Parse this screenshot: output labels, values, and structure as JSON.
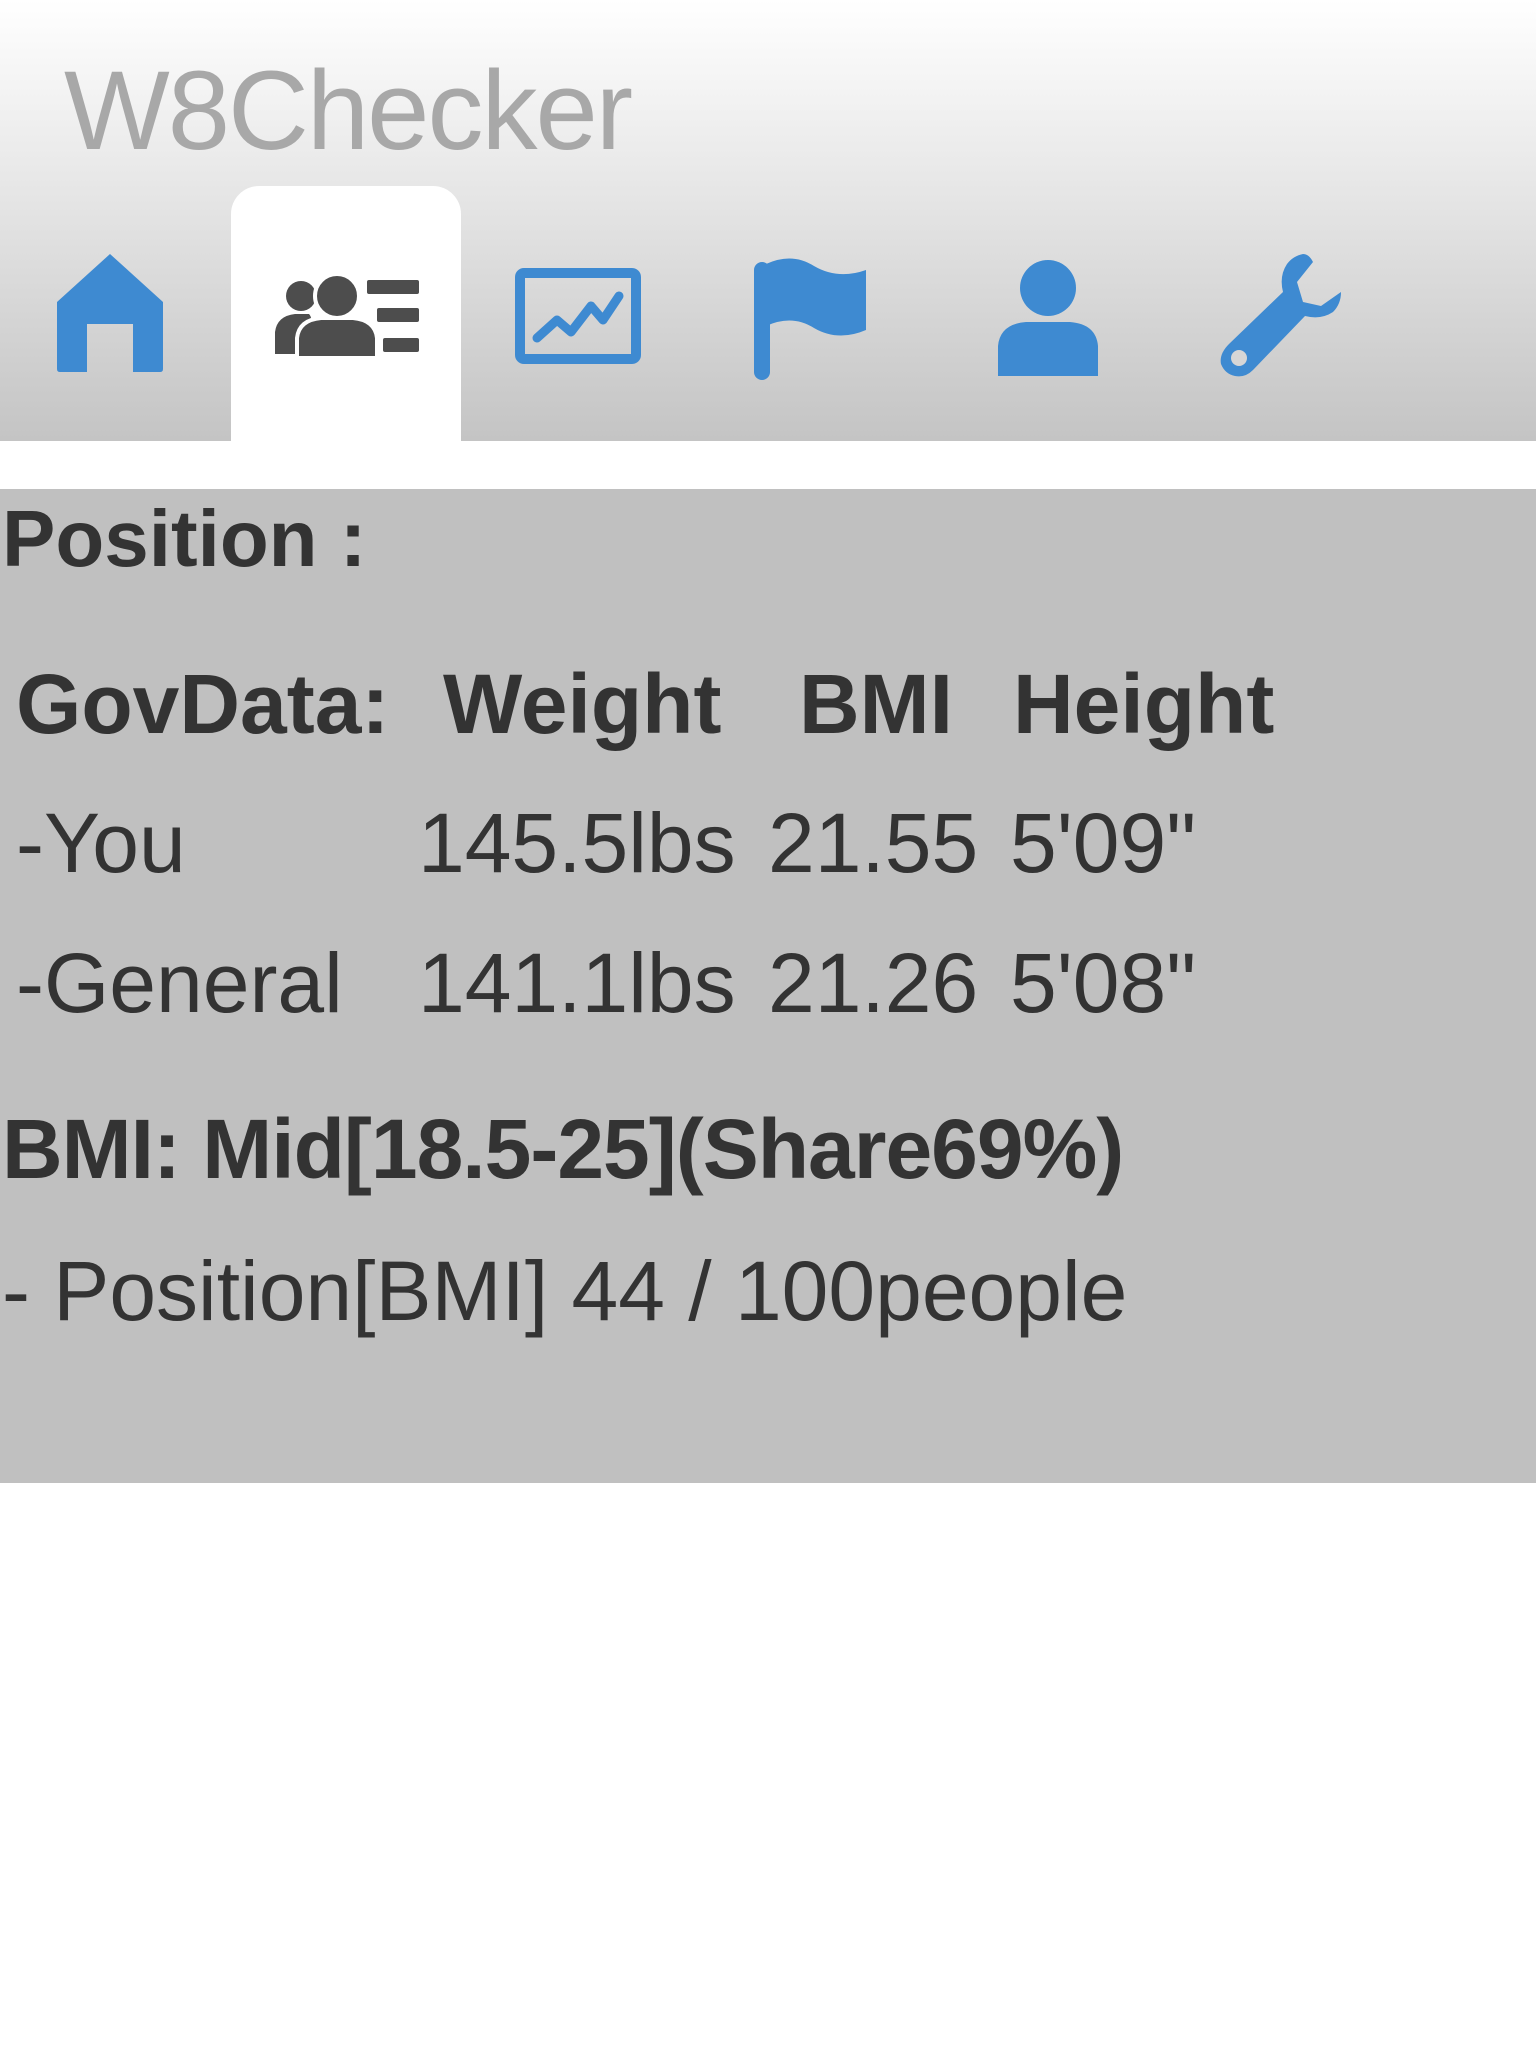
{
  "app": {
    "title": "W8Checker"
  },
  "tabs": [
    {
      "name": "home",
      "icon": "home-icon",
      "active": false
    },
    {
      "name": "people-list",
      "icon": "people-list-icon",
      "active": true
    },
    {
      "name": "chart",
      "icon": "line-chart-icon",
      "active": false
    },
    {
      "name": "flag",
      "icon": "flag-icon",
      "active": false
    },
    {
      "name": "profile",
      "icon": "person-icon",
      "active": false
    },
    {
      "name": "settings",
      "icon": "wrench-icon",
      "active": false
    }
  ],
  "colors": {
    "accent": "#3e8ad1",
    "active_icon": "#4d4d4d",
    "panel_bg": "#c0c0c0",
    "text": "#333333",
    "title_text": "#a8a8a8"
  },
  "position": {
    "title": "Position :",
    "table": {
      "headers": {
        "label": "GovData:",
        "weight": "Weight",
        "bmi": "BMI",
        "height": "Height"
      },
      "rows": [
        {
          "label": "-You",
          "weight": "145.5lbs",
          "bmi": "21.55",
          "height": "5'09\""
        },
        {
          "label": "-General",
          "weight": "141.1lbs",
          "bmi": "21.26",
          "height": "5'08\""
        }
      ]
    },
    "bmi_summary": "BMI: Mid[18.5-25](Share69%)",
    "position_line": "- Position[BMI] 44 / 100people"
  }
}
